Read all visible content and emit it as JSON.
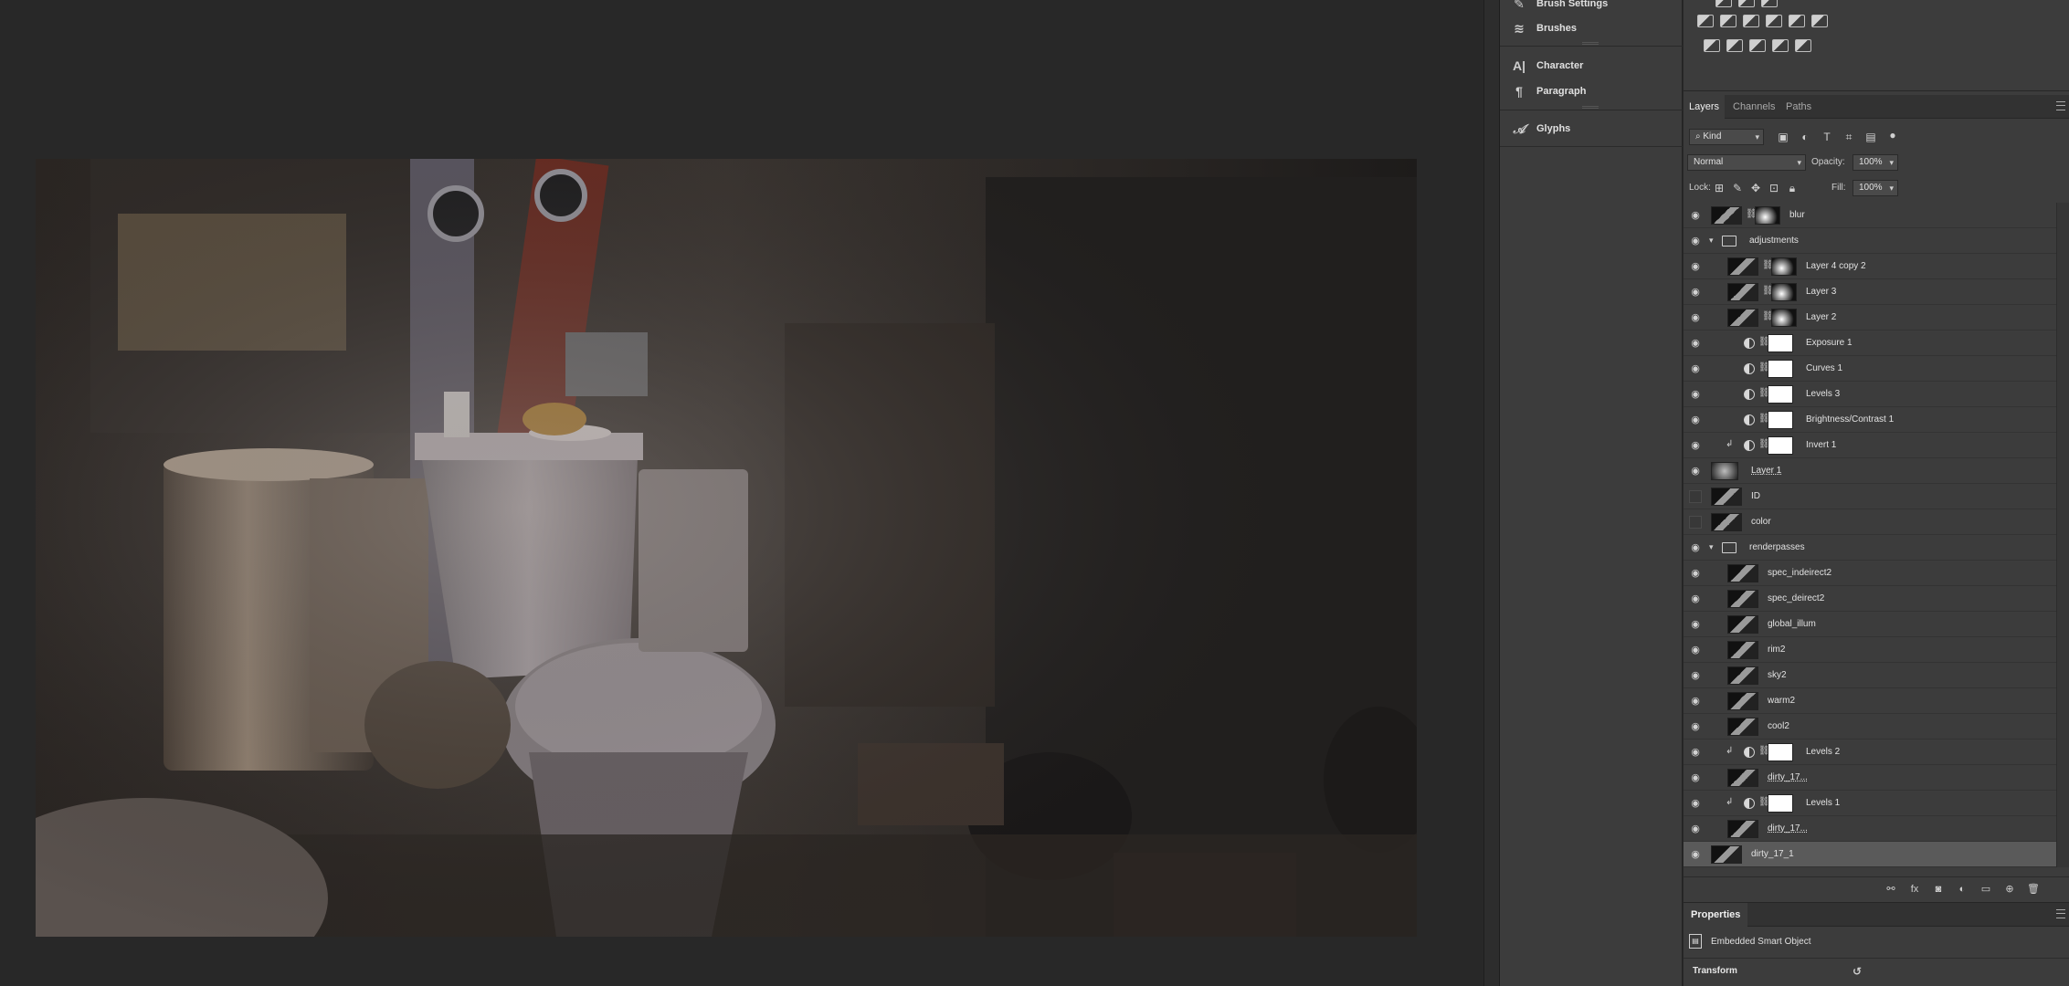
{
  "mini_panels": {
    "items": [
      {
        "label": "Brush Settings",
        "icon": "brush-settings-icon"
      },
      {
        "label": "Brushes",
        "icon": "brushes-icon"
      },
      {
        "label": "Character",
        "icon": "character-icon"
      },
      {
        "label": "Paragraph",
        "icon": "paragraph-icon"
      },
      {
        "label": "Glyphs",
        "icon": "glyphs-icon"
      }
    ]
  },
  "layers_panel": {
    "tabs": [
      {
        "label": "Layers",
        "active": true
      },
      {
        "label": "Channels",
        "active": false
      },
      {
        "label": "Paths",
        "active": false
      }
    ],
    "filter_kind": "Kind",
    "blend_mode": "Normal",
    "opacity_label": "Opacity:",
    "opacity_value": "100%",
    "lock_label": "Lock:",
    "fill_label": "Fill:",
    "fill_value": "100%",
    "layers": [
      {
        "name": "blur",
        "visible": true,
        "type": "pixel-mask",
        "indent": 0
      },
      {
        "name": "adjustments",
        "visible": true,
        "type": "group",
        "indent": 0
      },
      {
        "name": "Layer 4 copy 2",
        "visible": true,
        "type": "pixel-mask",
        "indent": 1
      },
      {
        "name": "Layer 3",
        "visible": true,
        "type": "pixel-mask",
        "indent": 1
      },
      {
        "name": "Layer 2",
        "visible": true,
        "type": "pixel-mask",
        "indent": 1
      },
      {
        "name": "Exposure 1",
        "visible": true,
        "type": "adjustment",
        "indent": 1
      },
      {
        "name": "Curves 1",
        "visible": true,
        "type": "adjustment",
        "indent": 1
      },
      {
        "name": "Levels 3",
        "visible": true,
        "type": "adjustment",
        "indent": 1
      },
      {
        "name": "Brightness/Contrast 1",
        "visible": true,
        "type": "adjustment",
        "indent": 1
      },
      {
        "name": "Invert 1",
        "visible": true,
        "type": "adjustment-clip",
        "indent": 1
      },
      {
        "name": "Layer 1",
        "visible": true,
        "type": "pixel",
        "indent": 0,
        "underline": true
      },
      {
        "name": "ID",
        "visible": false,
        "type": "smart",
        "indent": 0
      },
      {
        "name": "color",
        "visible": false,
        "type": "smart",
        "indent": 0
      },
      {
        "name": "renderpasses",
        "visible": true,
        "type": "group",
        "indent": 0
      },
      {
        "name": "spec_indeirect2",
        "visible": true,
        "type": "smart",
        "indent": 1
      },
      {
        "name": "spec_deirect2",
        "visible": true,
        "type": "smart",
        "indent": 1
      },
      {
        "name": "global_illum",
        "visible": true,
        "type": "smart",
        "indent": 1
      },
      {
        "name": "rim2",
        "visible": true,
        "type": "smart",
        "indent": 1
      },
      {
        "name": "sky2",
        "visible": true,
        "type": "smart",
        "indent": 1
      },
      {
        "name": "warm2",
        "visible": true,
        "type": "smart",
        "indent": 1
      },
      {
        "name": "cool2",
        "visible": true,
        "type": "smart",
        "indent": 1
      },
      {
        "name": "Levels 2",
        "visible": true,
        "type": "adjustment-clip",
        "indent": 1
      },
      {
        "name": "dirty_17...",
        "visible": true,
        "type": "smart",
        "indent": 1,
        "underline": true
      },
      {
        "name": "Levels 1",
        "visible": true,
        "type": "adjustment-clip",
        "indent": 1
      },
      {
        "name": "dirty_17...",
        "visible": true,
        "type": "smart",
        "indent": 1,
        "underline": true
      },
      {
        "name": "dirty_17_1",
        "visible": true,
        "type": "smart",
        "indent": 0,
        "selected": true
      }
    ]
  },
  "properties_panel": {
    "tab": "Properties",
    "kind": "Embedded Smart Object",
    "section": "Transform"
  },
  "colors": {
    "canvas_bg": "#282828",
    "panel_bg": "#3c3c3c",
    "selected_row": "#5a5a5a"
  }
}
